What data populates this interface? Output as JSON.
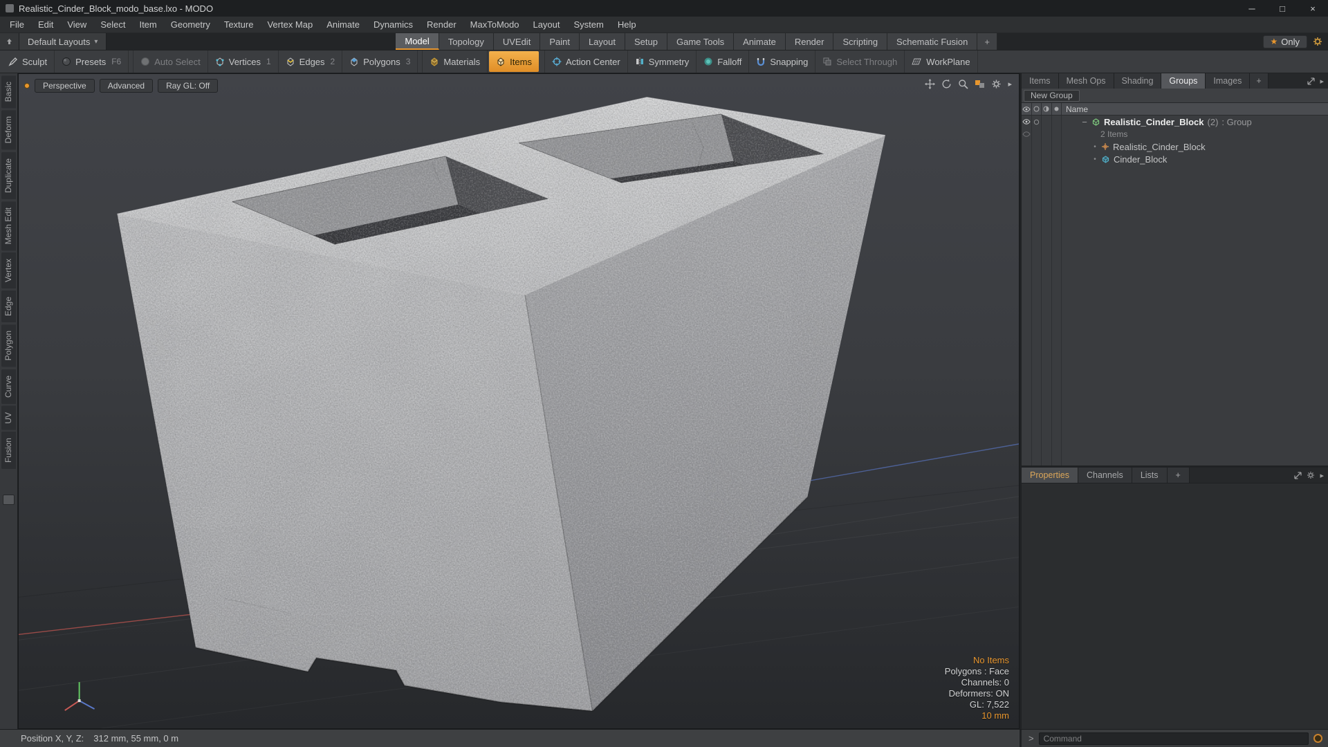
{
  "colors": {
    "accent_orange": "#e8962e",
    "items_button_top": "#f3b14c",
    "items_button_bottom": "#e08e27",
    "axis_red": "#c05550",
    "axis_green": "#63c863",
    "axis_blue": "#5a78c8"
  },
  "titlebar": {
    "title": "Realistic_Cinder_Block_modo_base.lxo - MODO",
    "minimize": "─",
    "maximize": "□",
    "close": "×"
  },
  "menubar": {
    "items": [
      "File",
      "Edit",
      "View",
      "Select",
      "Item",
      "Geometry",
      "Texture",
      "Vertex Map",
      "Animate",
      "Dynamics",
      "Render",
      "MaxToModo",
      "Layout",
      "System",
      "Help"
    ]
  },
  "layoutbar": {
    "switcher_label": "Default Layouts",
    "switcher_arrow": "▾",
    "tabs": [
      "Model",
      "Topology",
      "UVEdit",
      "Paint",
      "Layout",
      "Setup",
      "Game Tools",
      "Animate",
      "Render",
      "Scripting",
      "Schematic Fusion"
    ],
    "active_tab": "Model",
    "add_tab": "+",
    "star": "★",
    "only_label": "Only"
  },
  "toolbar": {
    "sculpt": "Sculpt",
    "presets": "Presets",
    "presets_key": "F6",
    "auto_select": "Auto Select",
    "vertices": "Vertices",
    "vertices_key": "1",
    "edges": "Edges",
    "edges_key": "2",
    "polygons": "Polygons",
    "polygons_key": "3",
    "materials": "Materials",
    "items": "Items",
    "action_center": "Action Center",
    "symmetry": "Symmetry",
    "falloff": "Falloff",
    "snapping": "Snapping",
    "select_through": "Select Through",
    "workplane": "WorkPlane"
  },
  "left_rail": {
    "tabs": [
      "Basic",
      "Deform",
      "Duplicate",
      "Mesh Edit",
      "Vertex",
      "Edge",
      "Polygon",
      "Curve",
      "UV",
      "Fusion"
    ]
  },
  "viewport": {
    "view_mode": "Perspective",
    "shading_mode": "Advanced",
    "raygl_label": "Ray GL: Off",
    "stats": {
      "items": "No Items",
      "selection_mode": "Polygons : Face",
      "channels": "Channels: 0",
      "deformers": "Deformers: ON",
      "gl_count": "GL: 7,522",
      "grid_size": "10 mm"
    }
  },
  "right_panel": {
    "tabs": [
      "Items",
      "Mesh Ops",
      "Shading",
      "Groups",
      "Images"
    ],
    "active_tab": "Groups",
    "add_tab": "+",
    "panel_menu_glyph": "▸",
    "new_group_label": "New Group",
    "name_header": "Name",
    "group_row": {
      "collapse_glyph": "−",
      "name": "Realistic_Cinder_Block",
      "count": "(2)",
      "type_suffix": ": Group",
      "items_count": "2 Items"
    },
    "children": [
      {
        "bullet": "•",
        "name": "Realistic_Cinder_Block"
      },
      {
        "bullet": "•",
        "name": "Cinder_Block"
      }
    ],
    "bottom_tabs": [
      "Properties",
      "Channels",
      "Lists"
    ],
    "bottom_active_tab": "Properties",
    "bottom_add_tab": "+"
  },
  "statusbar": {
    "position_label": "Position X, Y, Z:",
    "position_value": "312 mm, 55 mm, 0 m",
    "command_prompt": ">",
    "command_placeholder": "Command"
  }
}
